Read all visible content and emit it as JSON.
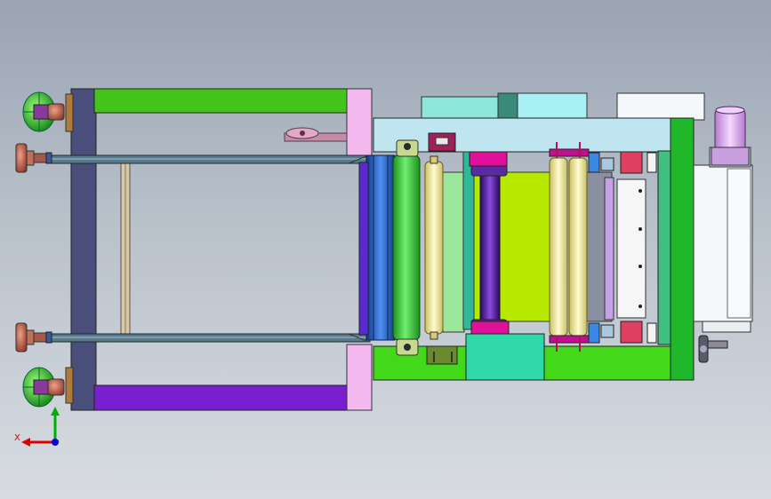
{
  "viewport": {
    "background_top": "#9aa4b2",
    "background_bottom": "#d8dce2"
  },
  "triad": {
    "x_label": "X",
    "x_color": "#e00000",
    "y_color": "#00b000",
    "z_color": "#0000dd"
  },
  "palette": {
    "frame_green": "#44c41a",
    "frame_purple": "#7a1fd0",
    "frame_dark": "#4a4e7a",
    "pink_plate": "#f3b8ee",
    "rail_steel": "#5a7a8c",
    "light_cyan": "#a8e6f0",
    "teal": "#2fb89a",
    "yellow_green": "#b6e800",
    "roller_yellow": "#f4f0a0",
    "roller_green": "#3bd13b",
    "roller_blue": "#2a66c8",
    "magenta": "#e0109a",
    "foot_brown": "#c0705a",
    "motor_lilac": "#e6b8f0"
  }
}
